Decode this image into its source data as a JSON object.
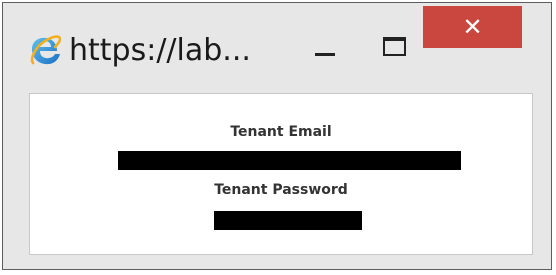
{
  "window": {
    "title": "https://lab...",
    "icon": "internet-explorer-icon",
    "minimize_icon": "minimize-icon",
    "maximize_icon": "maximize-icon",
    "close_symbol": "✕",
    "close_color": "#c9473f"
  },
  "form": {
    "email_label": "Tenant Email",
    "password_label": "Tenant Password",
    "email_value_redacted": true,
    "password_value_redacted": true
  }
}
